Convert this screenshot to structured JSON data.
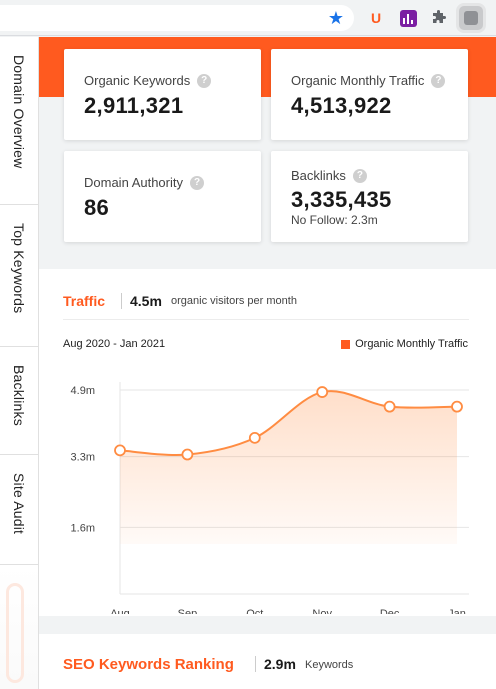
{
  "browser": {
    "toolbar_icons": [
      "star-icon",
      "ubersuggest-extension-icon",
      "chart-extension-icon",
      "puzzle-icon",
      "profile-avatar"
    ],
    "accent": "#1a73e8"
  },
  "sidebar": {
    "items": [
      {
        "label": "Domain Overview"
      },
      {
        "label": "Top Keywords"
      },
      {
        "label": "Backlinks"
      },
      {
        "label": "Site Audit"
      }
    ]
  },
  "brand": {
    "accent": "#ff5a1f"
  },
  "metrics": {
    "organic_keywords": {
      "label": "Organic Keywords",
      "value": "2,911,321"
    },
    "organic_traffic": {
      "label": "Organic Monthly Traffic",
      "value": "4,513,922"
    },
    "domain_authority": {
      "label": "Domain Authority",
      "value": "86"
    },
    "backlinks": {
      "label": "Backlinks",
      "value": "3,335,435",
      "sub": "No Follow: 2.3m"
    }
  },
  "traffic_panel": {
    "title": "Traffic",
    "value": "4.5m",
    "description": "organic visitors per month",
    "date_range": "Aug 2020 - Jan 2021",
    "legend": "Organic Monthly Traffic"
  },
  "chart_data": {
    "type": "area",
    "categories": [
      "Aug",
      "Sep",
      "Oct",
      "Nov",
      "Dec",
      "Jan"
    ],
    "series": [
      {
        "name": "Organic Monthly Traffic",
        "values": [
          3.45,
          3.35,
          3.75,
          4.85,
          4.5,
          4.5
        ],
        "color": "#ff8c42"
      }
    ],
    "ytick_labels": [
      "1.6m",
      "3.3m",
      "4.9m"
    ],
    "yticks": [
      1.6,
      3.3,
      4.9
    ],
    "ylim": [
      0,
      4.9
    ],
    "grid": true,
    "legend_position": "top-right"
  },
  "keywords_panel": {
    "title": "SEO Keywords Ranking",
    "value": "2.9m",
    "description": "Keywords"
  }
}
